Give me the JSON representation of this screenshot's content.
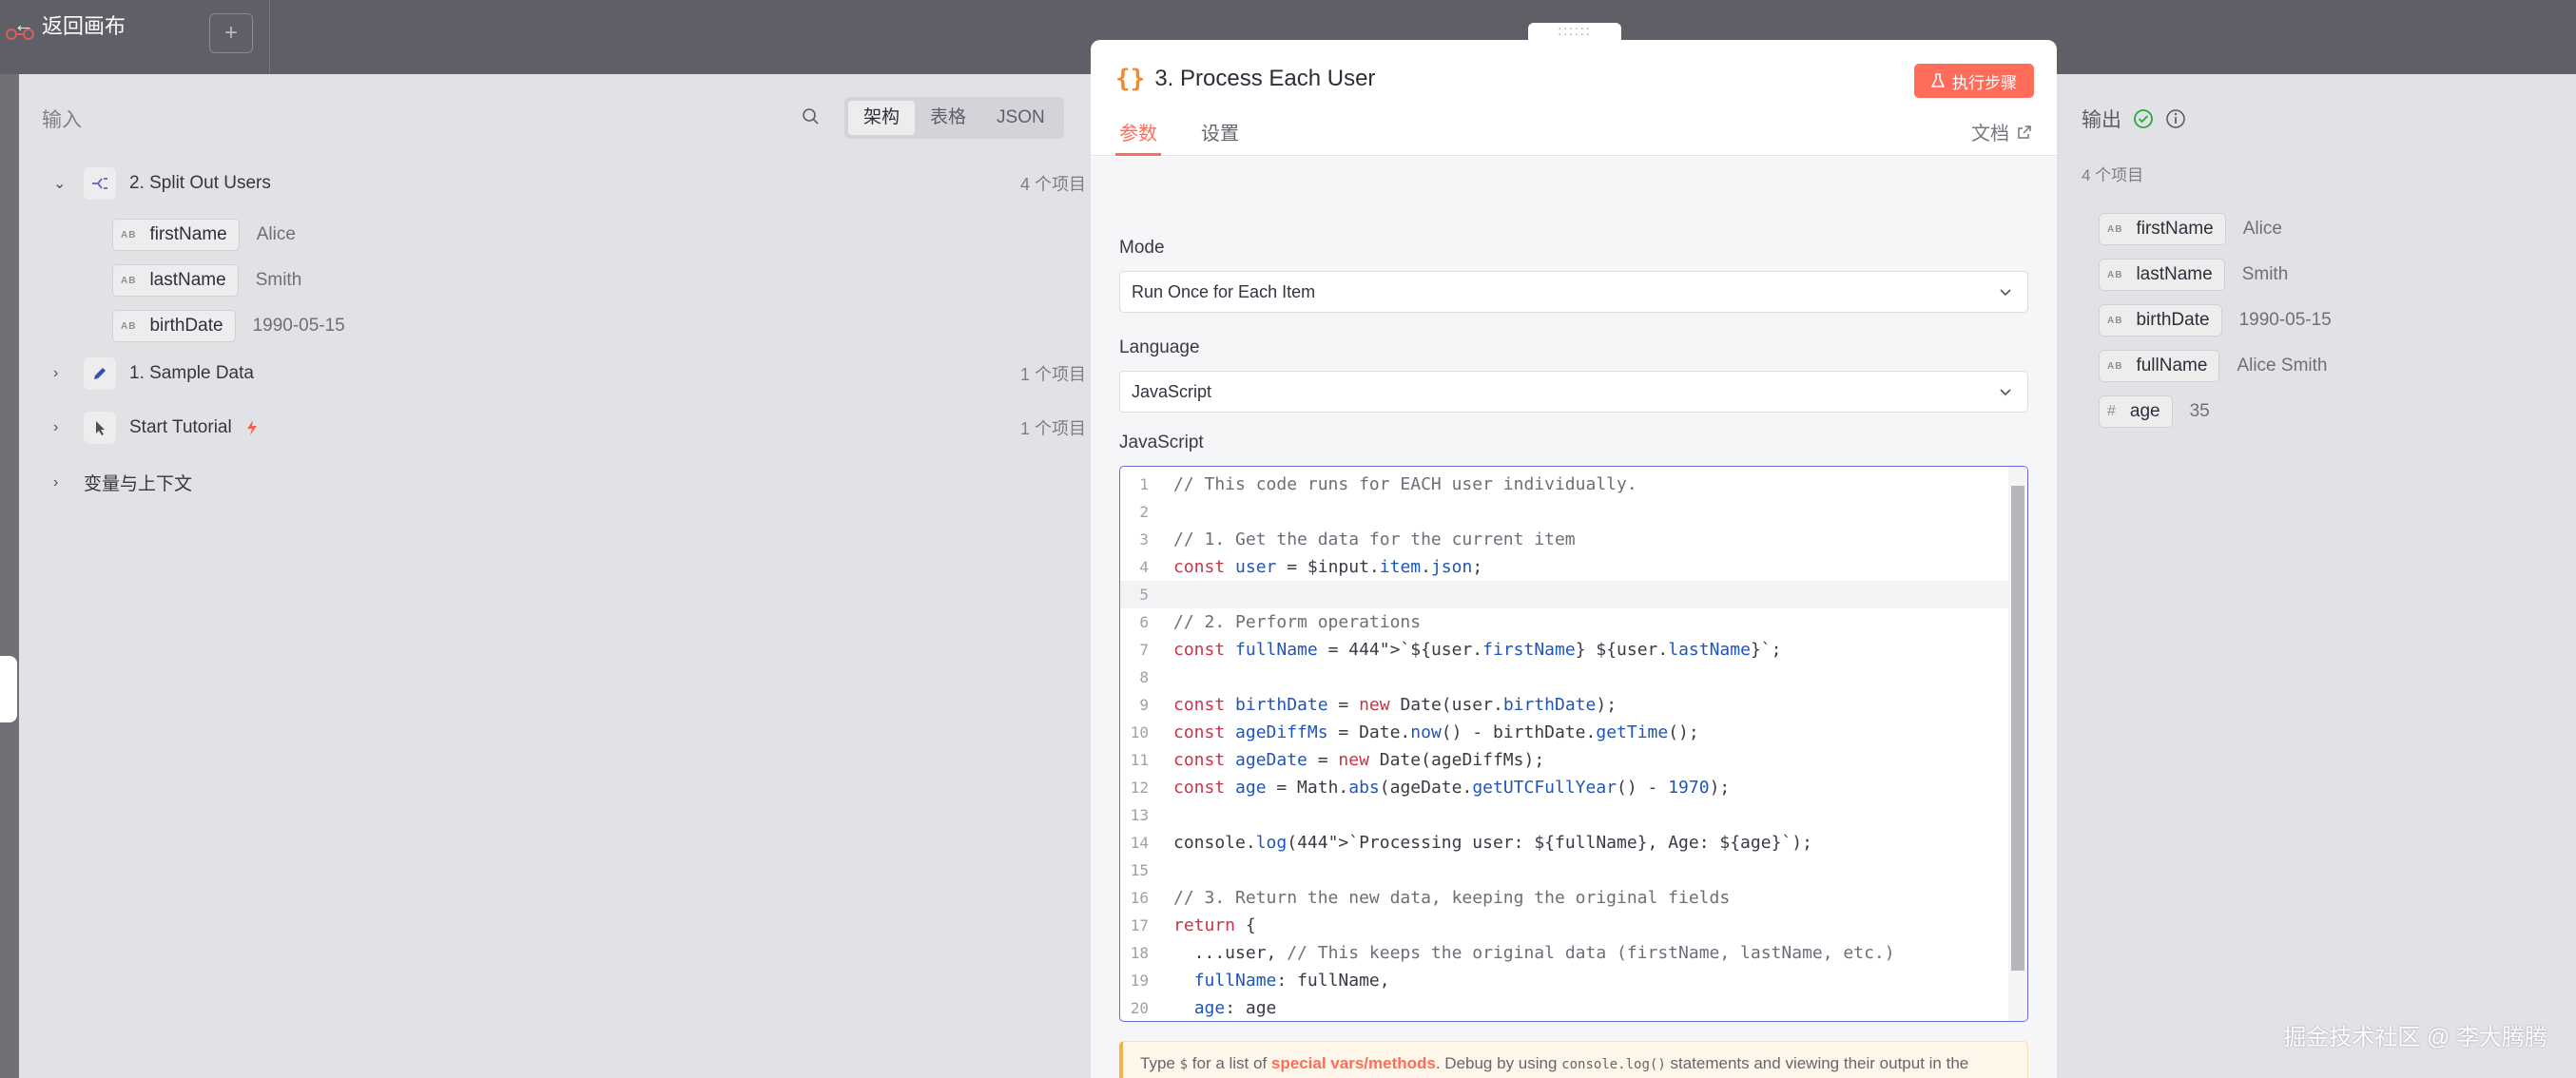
{
  "topbar": {
    "back_label": "返回画布",
    "back_arrow": "←",
    "plus": "+"
  },
  "input": {
    "title": "输入",
    "view_tabs": [
      "架构",
      "表格",
      "JSON"
    ],
    "active_view": "架构",
    "nodes": [
      {
        "name": "2. Split Out Users",
        "count": "4 个项目",
        "expanded": true
      },
      {
        "name": "1. Sample Data",
        "count": "1 个项目",
        "expanded": false
      },
      {
        "name": "Start Tutorial",
        "count": "1 个项目",
        "expanded": false
      }
    ],
    "fields": [
      {
        "key": "firstName",
        "type": "AB",
        "value": "Alice"
      },
      {
        "key": "lastName",
        "type": "AB",
        "value": "Smith"
      },
      {
        "key": "birthDate",
        "type": "AB",
        "value": "1990-05-15"
      }
    ],
    "vars_label": "变量与上下文"
  },
  "modal": {
    "drag_glyph": "::::::",
    "title": "3. Process Each User",
    "exec_label": "执行步骤",
    "tabs": [
      "参数",
      "设置"
    ],
    "docs_label": "文档",
    "mode_label": "Mode",
    "mode_value": "Run Once for Each Item",
    "language_label": "Language",
    "language_value": "JavaScript",
    "code_label": "JavaScript",
    "code_lines": [
      "// This code runs for EACH user individually.",
      "",
      "// 1. Get the data for the current item",
      "const user = $input.item.json;",
      "",
      "// 2. Perform operations",
      "const fullName = `${user.firstName} ${user.lastName}`;",
      "",
      "const birthDate = new Date(user.birthDate);",
      "const ageDiffMs = Date.now() - birthDate.getTime();",
      "const ageDate = new Date(ageDiffMs);",
      "const age = Math.abs(ageDate.getUTCFullYear() - 1970);",
      "",
      "console.log(`Processing user: ${fullName}, Age: ${age}`);",
      "",
      "// 3. Return the new data, keeping the original fields",
      "return {",
      "  ...user, // This keeps the original data (firstName, lastName, etc.)",
      "  fullName: fullName,",
      "  age: age"
    ],
    "hint": {
      "prefix": "Type",
      "dollar": "$",
      "mid": "for a list of",
      "link": "special vars/methods",
      "after": ". Debug by using",
      "code": "console.log()",
      "suffix": "statements and viewing their output in the browser console."
    }
  },
  "output": {
    "title": "输出",
    "count": "4 个项目",
    "fields": [
      {
        "key": "firstName",
        "type": "AB",
        "value": "Alice"
      },
      {
        "key": "lastName",
        "type": "AB",
        "value": "Smith"
      },
      {
        "key": "birthDate",
        "type": "AB",
        "value": "1990-05-15"
      },
      {
        "key": "fullName",
        "type": "AB",
        "value": "Alice Smith"
      },
      {
        "key": "age",
        "type": "#",
        "value": "35"
      }
    ]
  },
  "watermark": "掘金技术社区 @ 李大腾腾",
  "colors": {
    "accent": "#ff6d5a",
    "success": "#2fb344",
    "editor_border": "#6b6bd8"
  }
}
